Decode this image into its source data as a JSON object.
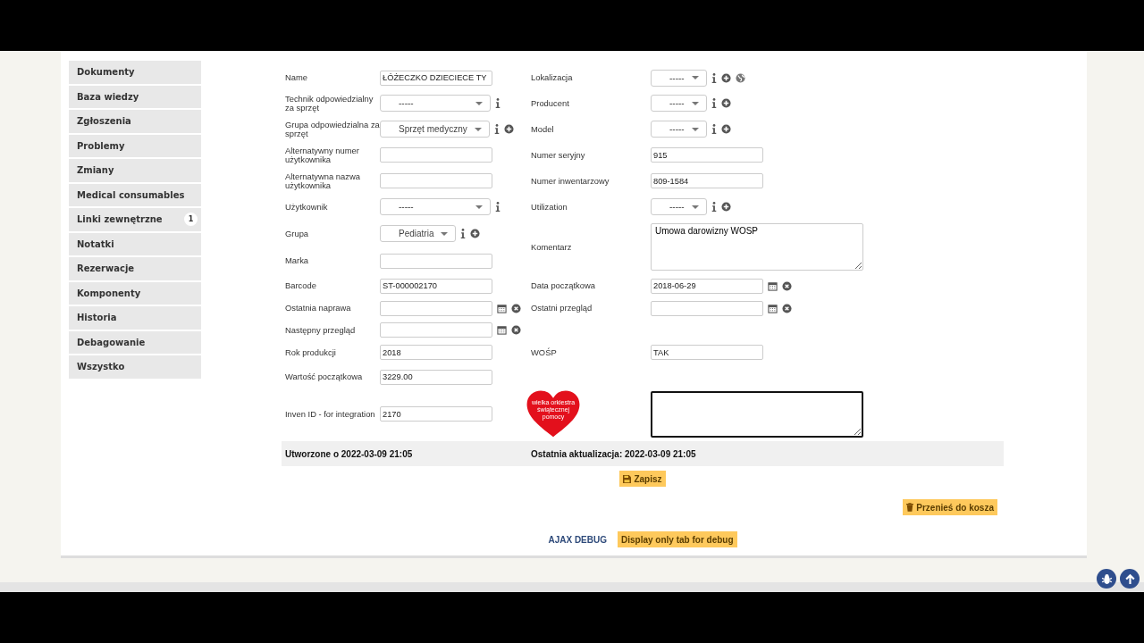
{
  "sidebar": {
    "items": [
      {
        "label": "Dokumenty",
        "selected": false
      },
      {
        "label": "Baza wiedzy",
        "selected": false
      },
      {
        "label": "Zgłoszenia",
        "selected": false
      },
      {
        "label": "Problemy",
        "selected": false
      },
      {
        "label": "Zmiany",
        "selected": false
      },
      {
        "label": "Medical consumables",
        "selected": false
      },
      {
        "label": "Linki zewnętrzne",
        "selected": false,
        "badge": "1"
      },
      {
        "label": "Notatki",
        "selected": false
      },
      {
        "label": "Rezerwacje",
        "selected": false
      },
      {
        "label": "Komponenty",
        "selected": false
      },
      {
        "label": "Historia",
        "selected": false
      },
      {
        "label": "Debagowanie",
        "selected": false
      },
      {
        "label": "Wszystko",
        "selected": false
      }
    ]
  },
  "form": {
    "rows": [
      {
        "left": {
          "label": "Name",
          "kind": "text",
          "value": "ŁÓŻECZKO DZIECIECE TY"
        },
        "right": {
          "label": "Lokalizacja",
          "kind": "select-plus-globe",
          "value": "-----"
        }
      },
      {
        "left": {
          "label": "Technik odpowiedzialny za sprzęt",
          "kind": "select",
          "value": "-----"
        },
        "right": {
          "label": "Producent",
          "kind": "select-plus",
          "value": "-----"
        }
      },
      {
        "left": {
          "label": "Grupa odpowiedzialna za sprzęt",
          "kind": "select-plus",
          "value": "Sprzęt medyczny"
        },
        "right": {
          "label": "Model",
          "kind": "select-plus",
          "value": "-----"
        }
      },
      {
        "left": {
          "label": "Alternatywny numer użytkownika",
          "kind": "text"
        },
        "right": {
          "label": "Numer seryjny",
          "kind": "text",
          "value": "915"
        }
      },
      {
        "left": {
          "label": "Alternatywna nazwa użytkownika",
          "kind": "text"
        },
        "right": {
          "label": "Numer inwentarzowy",
          "kind": "text",
          "value": "809-1584"
        }
      },
      {
        "left": {
          "label": "Użytkownik",
          "kind": "select",
          "value": "-----"
        },
        "right": {
          "label": "Utilization",
          "kind": "select-plus",
          "value": "-----"
        }
      },
      {
        "left": {
          "label": "Grupa",
          "kind": "select-plus",
          "value": "Pediatria"
        },
        "right": {
          "label": "Komentarz",
          "kind": "textarea",
          "value": "Umowa darowizny WOSP"
        }
      },
      {
        "left": {
          "label": "Marka",
          "kind": "text"
        }
      },
      {
        "left": {
          "label": "Barcode",
          "kind": "text",
          "value": "ST-000002170"
        },
        "right": {
          "label": "Data początkowa",
          "kind": "date",
          "value": "2018-06-29"
        }
      },
      {
        "left": {
          "label": "Ostatnia naprawa",
          "kind": "date"
        },
        "right": {
          "label": "Ostatni przegląd",
          "kind": "date"
        }
      },
      {
        "left": {
          "label": "Następny przegląd",
          "kind": "date"
        }
      },
      {
        "left": {
          "label": "Rok produkcji",
          "kind": "text",
          "value": "2018"
        },
        "right": {
          "label": "WOŚP",
          "kind": "text",
          "value": "TAK"
        }
      },
      {
        "left": {
          "label": "Wartość początkowa",
          "kind": "text",
          "value": "3229.00"
        }
      },
      {
        "left": {
          "label": "Inven ID - for integration",
          "kind": "text",
          "value": "2170"
        },
        "right": {
          "kind": "logo-textarea",
          "logo_lines": [
            "wielka orkiestra",
            "świątecznej",
            "pomocy"
          ],
          "focused": true
        }
      }
    ]
  },
  "created": "Utworzone o 2022-03-09 21:05",
  "updated": "Ostatnia aktualizacja: 2022-03-09 21:05",
  "save_button": "Zapisz",
  "trash_button": "Przenieś do kosza",
  "debug_link": "AJAX DEBUG",
  "debug_button": "Display only tab for debug"
}
